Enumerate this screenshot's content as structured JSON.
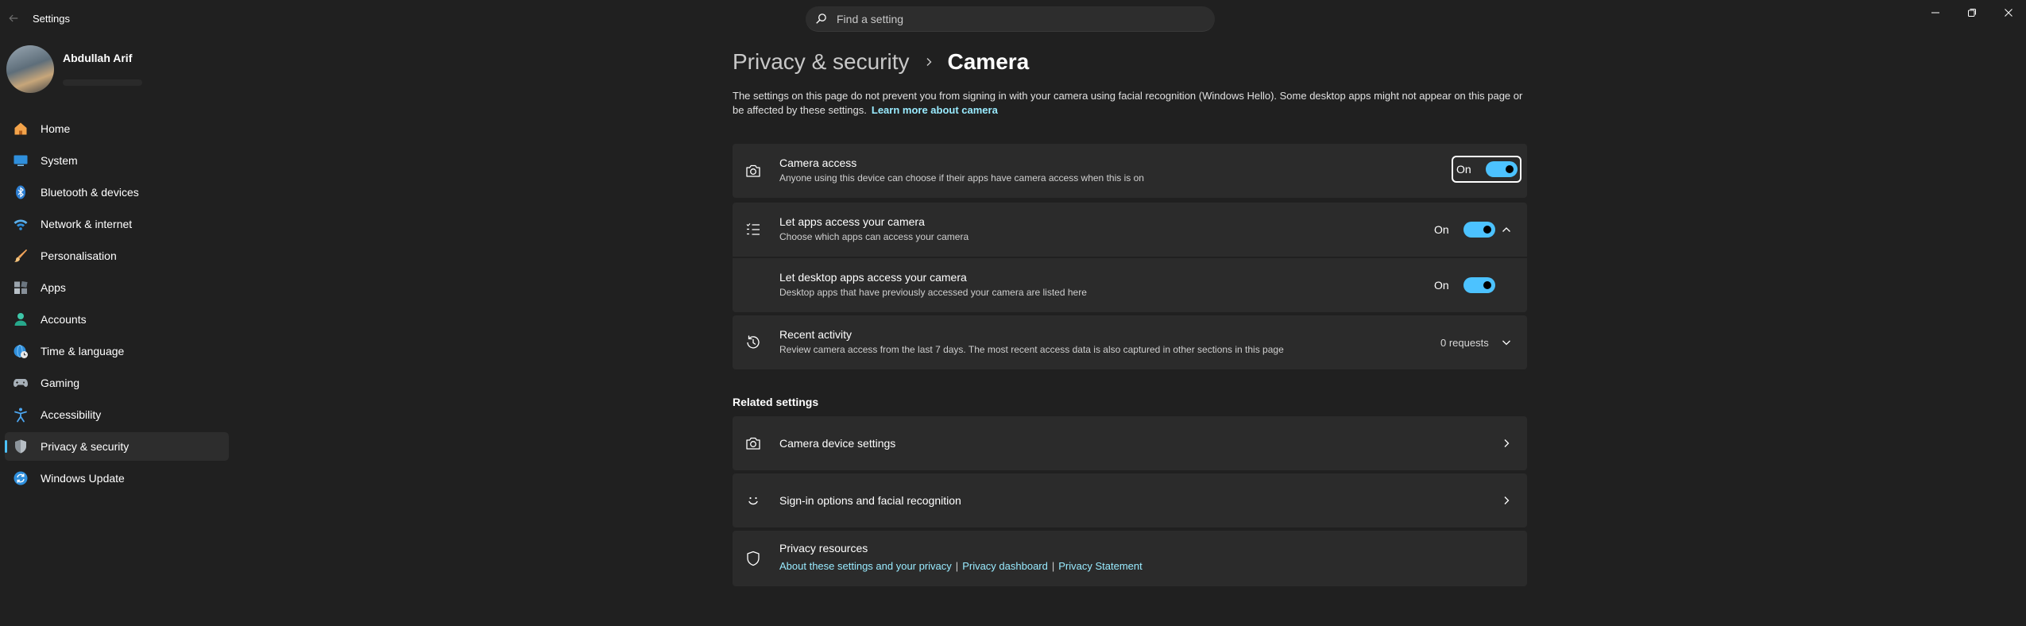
{
  "window": {
    "title": "Settings"
  },
  "search": {
    "placeholder": "Find a setting"
  },
  "profile": {
    "name": "Abdullah Arif"
  },
  "sidebar": {
    "items": [
      {
        "label": "Home",
        "icon": "home-icon"
      },
      {
        "label": "System",
        "icon": "system-icon"
      },
      {
        "label": "Bluetooth & devices",
        "icon": "bluetooth-icon"
      },
      {
        "label": "Network & internet",
        "icon": "wifi-icon"
      },
      {
        "label": "Personalisation",
        "icon": "brush-icon"
      },
      {
        "label": "Apps",
        "icon": "apps-icon"
      },
      {
        "label": "Accounts",
        "icon": "accounts-icon"
      },
      {
        "label": "Time & language",
        "icon": "globe-clock-icon"
      },
      {
        "label": "Gaming",
        "icon": "gamepad-icon"
      },
      {
        "label": "Accessibility",
        "icon": "accessibility-icon"
      },
      {
        "label": "Privacy & security",
        "icon": "shield-icon",
        "active": true
      },
      {
        "label": "Windows Update",
        "icon": "update-icon"
      }
    ]
  },
  "page": {
    "breadcrumb_parent": "Privacy & security",
    "breadcrumb_current": "Camera",
    "description": "The settings on this page do not prevent you from signing in with your camera using facial recognition (Windows Hello). Some desktop apps might not appear on this page or be affected by these settings.",
    "learn_more": "Learn more about camera"
  },
  "settings": {
    "camera_access": {
      "title": "Camera access",
      "subtitle": "Anyone using this device can choose if their apps have camera access when this is on",
      "state": "On"
    },
    "let_apps": {
      "title": "Let apps access your camera",
      "subtitle": "Choose which apps can access your camera",
      "state": "On"
    },
    "desktop_apps": {
      "title": "Let desktop apps access your camera",
      "subtitle": "Desktop apps that have previously accessed your camera are listed here",
      "state": "On"
    },
    "recent_activity": {
      "title": "Recent activity",
      "subtitle": "Review camera access from the last 7 days. The most recent access data is also captured in other sections in this page",
      "value": "0 requests"
    }
  },
  "related": {
    "heading": "Related settings",
    "camera_device": "Camera device settings",
    "signin_options": "Sign-in options and facial recognition",
    "privacy_resources": {
      "title": "Privacy resources",
      "links": [
        "About these settings and your privacy",
        "Privacy dashboard",
        "Privacy Statement"
      ]
    }
  },
  "colors": {
    "accent": "#4cc2ff",
    "link": "#99ebff",
    "background": "#202020",
    "card": "#2b2b2b"
  }
}
